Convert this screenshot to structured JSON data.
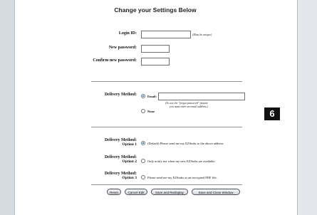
{
  "page_title": "Change your Settings Below",
  "login": {
    "label": "Login ID:",
    "value": "",
    "note": "(Must be unique)"
  },
  "new_password": {
    "label": "New password:",
    "value": ""
  },
  "confirm_password": {
    "label": "Confirm new password:",
    "value": ""
  },
  "delivery_method": {
    "label": "Delivery Method:",
    "email_label": "Email:",
    "email_value": "",
    "email_note_line1": "(To use the \"forgot password\" feature",
    "email_note_line2": "you must enter an email address.)",
    "none_label": "None",
    "selected": "email"
  },
  "options": [
    {
      "label": "Delivery Method:",
      "sub": "Option 1",
      "text": "(Default) Please send me my EZStubs to the above address.",
      "selected": true
    },
    {
      "label": "Delivery Method:",
      "sub": "Option 2",
      "text": "Only notify me when my new EZStubs are available.",
      "selected": false
    },
    {
      "label": "Delivery Method:",
      "sub": "Option 3",
      "text": "Please send me my EZStubs as an encrypted PDF file.",
      "selected": false
    }
  ],
  "badge": "6",
  "buttons": {
    "reset": "Reset",
    "cancel_edit": "Cancel Edit",
    "save_redisplay": "Save and Redisplay",
    "save_close": "Save and Close Window"
  }
}
